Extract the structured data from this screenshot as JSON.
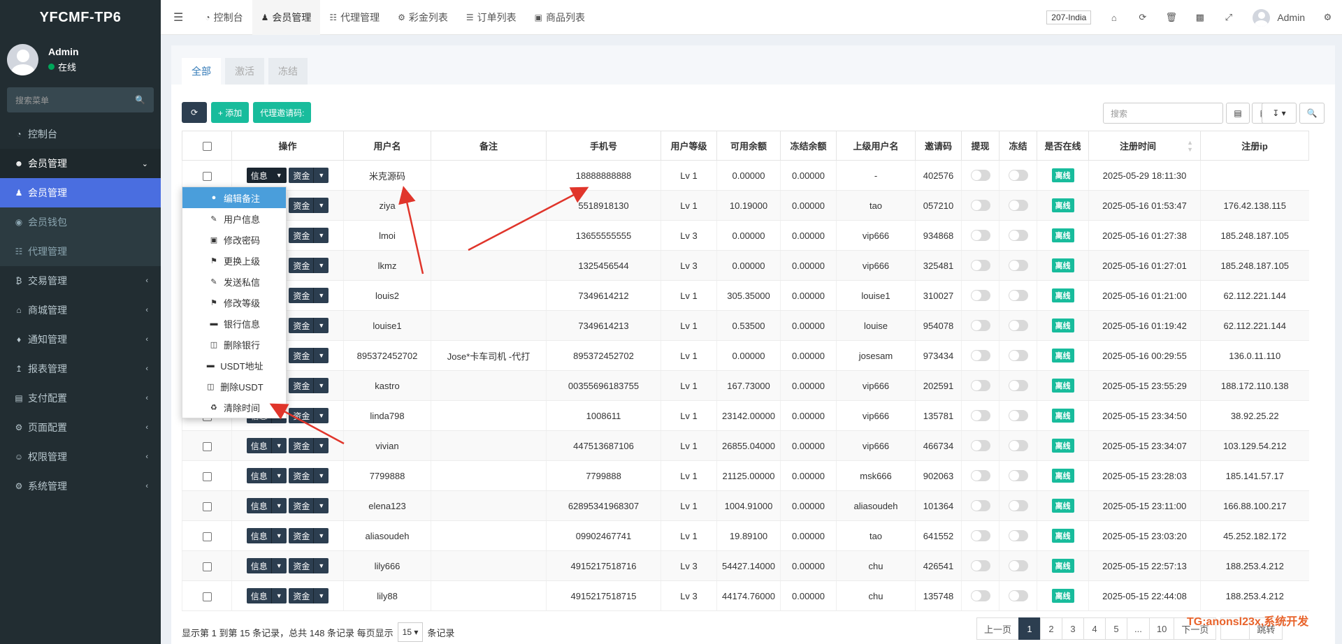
{
  "app": {
    "title": "YFCMF-TP6"
  },
  "user": {
    "name": "Admin",
    "status": "在线"
  },
  "sidebar": {
    "search_placeholder": "搜索菜单",
    "items": [
      {
        "label": "控制台",
        "icon": "dashboard-icon"
      },
      {
        "label": "会员管理",
        "icon": "user-circle-icon",
        "open": true
      },
      {
        "label": "会员管理",
        "icon": "user-icon",
        "active": true,
        "sub": true
      },
      {
        "label": "会员钱包",
        "icon": "wallet-icon",
        "sub": true
      },
      {
        "label": "代理管理",
        "icon": "sitemap-icon",
        "sub": true
      },
      {
        "label": "交易管理",
        "icon": "bitcoin-icon"
      },
      {
        "label": "商城管理",
        "icon": "home-icon"
      },
      {
        "label": "通知管理",
        "icon": "bell-icon"
      },
      {
        "label": "报表管理",
        "icon": "chart-icon"
      },
      {
        "label": "支付配置",
        "icon": "credit-card-icon"
      },
      {
        "label": "页面配置",
        "icon": "gear-icon"
      },
      {
        "label": "权限管理",
        "icon": "users-icon"
      },
      {
        "label": "系统管理",
        "icon": "cogs-icon"
      }
    ]
  },
  "topnav": {
    "tabs": [
      {
        "label": "控制台"
      },
      {
        "label": "会员管理",
        "active": true
      },
      {
        "label": "代理管理"
      },
      {
        "label": "彩金列表"
      },
      {
        "label": "订单列表"
      },
      {
        "label": "商品列表"
      }
    ],
    "lang": "207-India",
    "admin": "Admin"
  },
  "content": {
    "tabs": [
      "全部",
      "激活",
      "冻结"
    ],
    "add_label": "+ 添加",
    "invite_label": "代理邀请码:",
    "search_placeholder": "搜索"
  },
  "table": {
    "columns": [
      "操作",
      "用户名",
      "备注",
      "手机号",
      "用户等级",
      "可用余额",
      "冻结余额",
      "上级用户名",
      "邀请码",
      "提现",
      "冻结",
      "是否在线",
      "注册时间",
      "注册ip"
    ],
    "info_label": "信息",
    "funds_label": "资金",
    "badge_label": "离线",
    "rows": [
      [
        "米克源码",
        "",
        "18888888888",
        "Lv 1",
        "0.00000",
        "0.00000",
        "-",
        "402576",
        "2025-05-29 18:11:30",
        ""
      ],
      [
        "ziya",
        "",
        "5518918130",
        "Lv 1",
        "10.19000",
        "0.00000",
        "tao",
        "057210",
        "2025-05-16 01:53:47",
        "176.42.138.115"
      ],
      [
        "lmoi",
        "",
        "13655555555",
        "Lv 3",
        "0.00000",
        "0.00000",
        "vip666",
        "934868",
        "2025-05-16 01:27:38",
        "185.248.187.105"
      ],
      [
        "lkmz",
        "",
        "1325456544",
        "Lv 3",
        "0.00000",
        "0.00000",
        "vip666",
        "325481",
        "2025-05-16 01:27:01",
        "185.248.187.105"
      ],
      [
        "louis2",
        "",
        "7349614212",
        "Lv 1",
        "305.35000",
        "0.00000",
        "louise1",
        "310027",
        "2025-05-16 01:21:00",
        "62.112.221.144"
      ],
      [
        "louise1",
        "",
        "7349614213",
        "Lv 1",
        "0.53500",
        "0.00000",
        "louise",
        "954078",
        "2025-05-16 01:19:42",
        "62.112.221.144"
      ],
      [
        "895372452702",
        "Jose*卡车司机 -代打",
        "895372452702",
        "Lv 1",
        "0.00000",
        "0.00000",
        "josesam",
        "973434",
        "2025-05-16 00:29:55",
        "136.0.11.110"
      ],
      [
        "kastro",
        "",
        "00355696183755",
        "Lv 1",
        "167.73000",
        "0.00000",
        "vip666",
        "202591",
        "2025-05-15 23:55:29",
        "188.172.110.138"
      ],
      [
        "linda798",
        "",
        "1008611",
        "Lv 1",
        "23142.00000",
        "0.00000",
        "vip666",
        "135781",
        "2025-05-15 23:34:50",
        "38.92.25.22"
      ],
      [
        "vivian",
        "",
        "447513687106",
        "Lv 1",
        "26855.04000",
        "0.00000",
        "vip666",
        "466734",
        "2025-05-15 23:34:07",
        "103.129.54.212"
      ],
      [
        "7799888",
        "",
        "7799888",
        "Lv 1",
        "21125.00000",
        "0.00000",
        "msk666",
        "902063",
        "2025-05-15 23:28:03",
        "185.141.57.17"
      ],
      [
        "elena123",
        "",
        "62895341968307",
        "Lv 1",
        "1004.91000",
        "0.00000",
        "aliasoudeh",
        "101364",
        "2025-05-15 23:11:00",
        "166.88.100.217"
      ],
      [
        "aliasoudeh",
        "",
        "09902467741",
        "Lv 1",
        "19.89100",
        "0.00000",
        "tao",
        "641552",
        "2025-05-15 23:03:20",
        "45.252.182.172"
      ],
      [
        "lily666",
        "",
        "4915217518716",
        "Lv 3",
        "54427.14000",
        "0.00000",
        "chu",
        "426541",
        "2025-05-15 22:57:13",
        "188.253.4.212"
      ],
      [
        "lily88",
        "",
        "4915217518715",
        "Lv 3",
        "44174.76000",
        "0.00000",
        "chu",
        "135748",
        "2025-05-15 22:44:08",
        "188.253.4.212"
      ]
    ]
  },
  "dropdown": {
    "items": [
      {
        "label": "编辑备注",
        "icon": "comment-icon",
        "hover": true
      },
      {
        "label": "用户信息",
        "icon": "pencil-icon"
      },
      {
        "label": "修改密码",
        "icon": "lock-icon"
      },
      {
        "label": "更换上级",
        "icon": "flag-icon"
      },
      {
        "label": "发送私信",
        "icon": "pencil-icon"
      },
      {
        "label": "修改等级",
        "icon": "flag-icon"
      },
      {
        "label": "银行信息",
        "icon": "card-icon"
      },
      {
        "label": "删除银行",
        "icon": "trash-icon"
      },
      {
        "label": "USDT地址",
        "icon": "card-icon"
      },
      {
        "label": "删除USDT",
        "icon": "trash-icon"
      },
      {
        "label": "清除时间",
        "icon": "recycle-icon"
      }
    ]
  },
  "footer": {
    "info_prefix": "显示第 1 到第 15 条记录，总共 148 条记录 每页显示",
    "page_size": "15",
    "info_suffix": "条记录",
    "prev": "上一页",
    "pages": [
      "1",
      "2",
      "3",
      "4",
      "5",
      "...",
      "10"
    ],
    "next": "下一页",
    "jump": "跳转"
  },
  "watermark": "TG:anonsl23x,系统开发",
  "colors": {
    "sidebar": "#222d32",
    "active": "#4a6ee0",
    "teal": "#18bc9c",
    "dark_btn": "#2c3e50",
    "arrow": "#e0352b"
  }
}
